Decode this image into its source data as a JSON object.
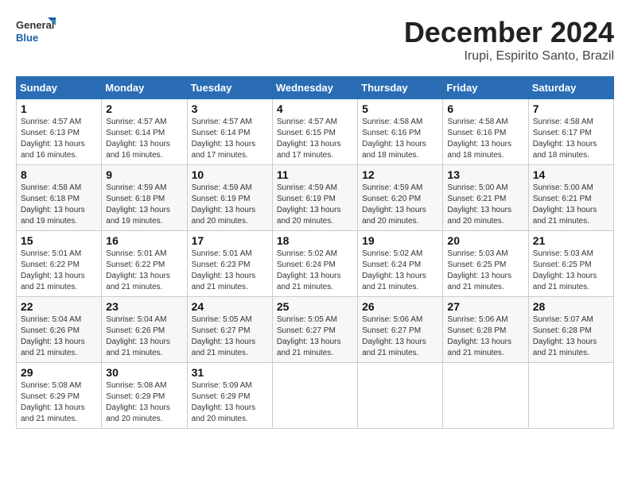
{
  "header": {
    "logo_line1": "General",
    "logo_line2": "Blue",
    "month": "December 2024",
    "location": "Irupi, Espirito Santo, Brazil"
  },
  "weekdays": [
    "Sunday",
    "Monday",
    "Tuesday",
    "Wednesday",
    "Thursday",
    "Friday",
    "Saturday"
  ],
  "weeks": [
    [
      {
        "day": 1,
        "info": "Sunrise: 4:57 AM\nSunset: 6:13 PM\nDaylight: 13 hours\nand 16 minutes."
      },
      {
        "day": 2,
        "info": "Sunrise: 4:57 AM\nSunset: 6:14 PM\nDaylight: 13 hours\nand 16 minutes."
      },
      {
        "day": 3,
        "info": "Sunrise: 4:57 AM\nSunset: 6:14 PM\nDaylight: 13 hours\nand 17 minutes."
      },
      {
        "day": 4,
        "info": "Sunrise: 4:57 AM\nSunset: 6:15 PM\nDaylight: 13 hours\nand 17 minutes."
      },
      {
        "day": 5,
        "info": "Sunrise: 4:58 AM\nSunset: 6:16 PM\nDaylight: 13 hours\nand 18 minutes."
      },
      {
        "day": 6,
        "info": "Sunrise: 4:58 AM\nSunset: 6:16 PM\nDaylight: 13 hours\nand 18 minutes."
      },
      {
        "day": 7,
        "info": "Sunrise: 4:58 AM\nSunset: 6:17 PM\nDaylight: 13 hours\nand 18 minutes."
      }
    ],
    [
      {
        "day": 8,
        "info": "Sunrise: 4:58 AM\nSunset: 6:18 PM\nDaylight: 13 hours\nand 19 minutes."
      },
      {
        "day": 9,
        "info": "Sunrise: 4:59 AM\nSunset: 6:18 PM\nDaylight: 13 hours\nand 19 minutes."
      },
      {
        "day": 10,
        "info": "Sunrise: 4:59 AM\nSunset: 6:19 PM\nDaylight: 13 hours\nand 20 minutes."
      },
      {
        "day": 11,
        "info": "Sunrise: 4:59 AM\nSunset: 6:19 PM\nDaylight: 13 hours\nand 20 minutes."
      },
      {
        "day": 12,
        "info": "Sunrise: 4:59 AM\nSunset: 6:20 PM\nDaylight: 13 hours\nand 20 minutes."
      },
      {
        "day": 13,
        "info": "Sunrise: 5:00 AM\nSunset: 6:21 PM\nDaylight: 13 hours\nand 20 minutes."
      },
      {
        "day": 14,
        "info": "Sunrise: 5:00 AM\nSunset: 6:21 PM\nDaylight: 13 hours\nand 21 minutes."
      }
    ],
    [
      {
        "day": 15,
        "info": "Sunrise: 5:01 AM\nSunset: 6:22 PM\nDaylight: 13 hours\nand 21 minutes."
      },
      {
        "day": 16,
        "info": "Sunrise: 5:01 AM\nSunset: 6:22 PM\nDaylight: 13 hours\nand 21 minutes."
      },
      {
        "day": 17,
        "info": "Sunrise: 5:01 AM\nSunset: 6:23 PM\nDaylight: 13 hours\nand 21 minutes."
      },
      {
        "day": 18,
        "info": "Sunrise: 5:02 AM\nSunset: 6:24 PM\nDaylight: 13 hours\nand 21 minutes."
      },
      {
        "day": 19,
        "info": "Sunrise: 5:02 AM\nSunset: 6:24 PM\nDaylight: 13 hours\nand 21 minutes."
      },
      {
        "day": 20,
        "info": "Sunrise: 5:03 AM\nSunset: 6:25 PM\nDaylight: 13 hours\nand 21 minutes."
      },
      {
        "day": 21,
        "info": "Sunrise: 5:03 AM\nSunset: 6:25 PM\nDaylight: 13 hours\nand 21 minutes."
      }
    ],
    [
      {
        "day": 22,
        "info": "Sunrise: 5:04 AM\nSunset: 6:26 PM\nDaylight: 13 hours\nand 21 minutes."
      },
      {
        "day": 23,
        "info": "Sunrise: 5:04 AM\nSunset: 6:26 PM\nDaylight: 13 hours\nand 21 minutes."
      },
      {
        "day": 24,
        "info": "Sunrise: 5:05 AM\nSunset: 6:27 PM\nDaylight: 13 hours\nand 21 minutes."
      },
      {
        "day": 25,
        "info": "Sunrise: 5:05 AM\nSunset: 6:27 PM\nDaylight: 13 hours\nand 21 minutes."
      },
      {
        "day": 26,
        "info": "Sunrise: 5:06 AM\nSunset: 6:27 PM\nDaylight: 13 hours\nand 21 minutes."
      },
      {
        "day": 27,
        "info": "Sunrise: 5:06 AM\nSunset: 6:28 PM\nDaylight: 13 hours\nand 21 minutes."
      },
      {
        "day": 28,
        "info": "Sunrise: 5:07 AM\nSunset: 6:28 PM\nDaylight: 13 hours\nand 21 minutes."
      }
    ],
    [
      {
        "day": 29,
        "info": "Sunrise: 5:08 AM\nSunset: 6:29 PM\nDaylight: 13 hours\nand 21 minutes."
      },
      {
        "day": 30,
        "info": "Sunrise: 5:08 AM\nSunset: 6:29 PM\nDaylight: 13 hours\nand 20 minutes."
      },
      {
        "day": 31,
        "info": "Sunrise: 5:09 AM\nSunset: 6:29 PM\nDaylight: 13 hours\nand 20 minutes."
      },
      null,
      null,
      null,
      null
    ]
  ]
}
